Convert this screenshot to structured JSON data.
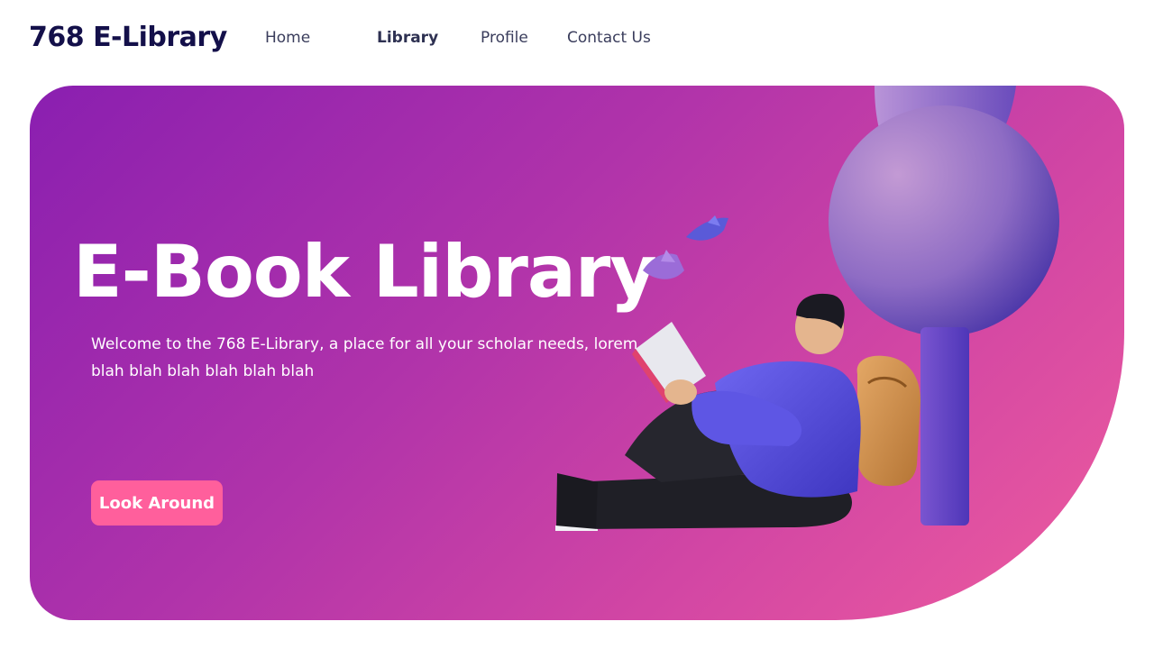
{
  "header": {
    "logo": "768 E-Library",
    "nav": [
      {
        "label": "Home"
      },
      {
        "label": "Library",
        "active": true
      },
      {
        "label": "Profile"
      },
      {
        "label": "Contact Us"
      }
    ]
  },
  "hero": {
    "title": "E-Book Library",
    "description": "Welcome to the 768 E-Library, a place for all your scholar needs, lorem blah blah blah blah blah blah",
    "cta_label": "Look Around",
    "illustration": "person-reading-under-tree-illustration",
    "colors": {
      "gradient_start": "#8a1fb0",
      "gradient_end": "#ee5c9e",
      "cta": "#ff5f9c",
      "logo": "#14104a"
    }
  }
}
